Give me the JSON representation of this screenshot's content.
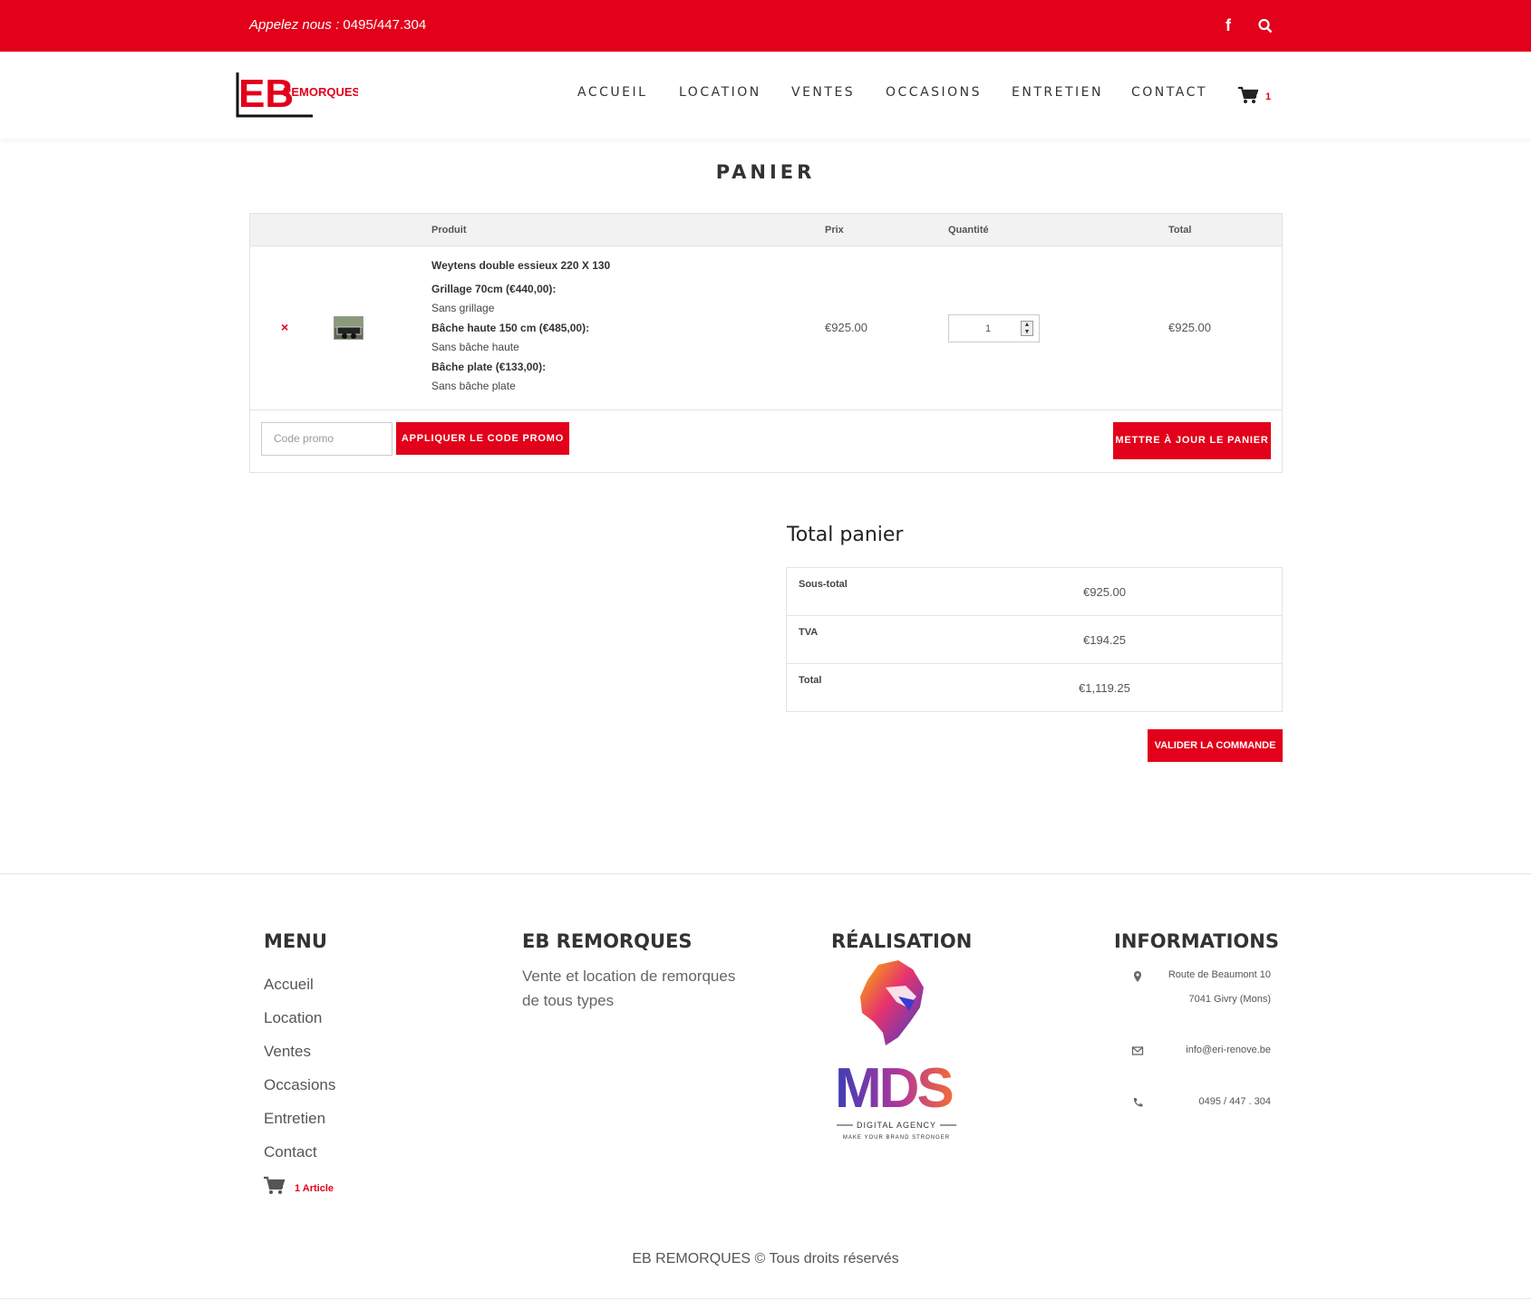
{
  "topbar": {
    "phone_label": "Appelez nous :",
    "phone_number": "0495/447.304",
    "facebook_icon": "facebook-icon",
    "search_icon": "search-icon"
  },
  "brand": {
    "logo_mark": "EB",
    "logo_text": "REMORQUES",
    "accent_color": "#e2001a"
  },
  "nav": {
    "items": [
      "ACCUEIL",
      "LOCATION",
      "VENTES",
      "OCCASIONS",
      "ENTRETIEN",
      "CONTACT"
    ],
    "cart_count": "1"
  },
  "page_title": "PANIER",
  "cart": {
    "headers": {
      "product": "Produit",
      "price": "Prix",
      "quantity": "Quantité",
      "total": "Total"
    },
    "item": {
      "remove": "×",
      "name": "Weytens double essieux 220 X 130",
      "options": [
        {
          "label": "Grillage 70cm (€440,00):",
          "value": "Sans grillage"
        },
        {
          "label": "Bâche haute 150 cm (€485,00):",
          "value": "Sans bâche haute"
        },
        {
          "label": "Bâche plate (€133,00):",
          "value": "Sans bâche plate"
        }
      ],
      "price": "€925.00",
      "quantity": "1",
      "total": "€925.00"
    },
    "promo_placeholder": "Code promo",
    "apply_promo": "APPLIQUER LE CODE PROMO",
    "update_cart": "METTRE À JOUR LE PANIER"
  },
  "totals": {
    "title": "Total panier",
    "rows": [
      {
        "label": "Sous-total",
        "value": "€925.00"
      },
      {
        "label": "TVA",
        "value": "€194.25"
      },
      {
        "label": "Total",
        "value": "€1,119.25"
      }
    ],
    "checkout": "VALIDER LA COMMANDE"
  },
  "footer": {
    "menu_title": "MENU",
    "menu_items": [
      "Accueil",
      "Location",
      "Ventes",
      "Occasions",
      "Entretien",
      "Contact"
    ],
    "cart_label": "1 Article",
    "about_title": "EB REMORQUES",
    "about_text": "Vente et location de remorques de tous types",
    "realisation_title": "RÉALISATION",
    "agency_name": "MDS",
    "agency_sub": "DIGITAL AGENCY",
    "agency_tagline": "MAKE YOUR BRAND STRONGER",
    "info_title": "INFORMATIONS",
    "address_line1": "Route de Beaumont 10",
    "address_line2": "7041 Givry (Mons)",
    "email": "info@eri-renove.be",
    "phone": "0495 / 447 . 304",
    "copyright": "EB REMORQUES © Tous droits réservés"
  }
}
